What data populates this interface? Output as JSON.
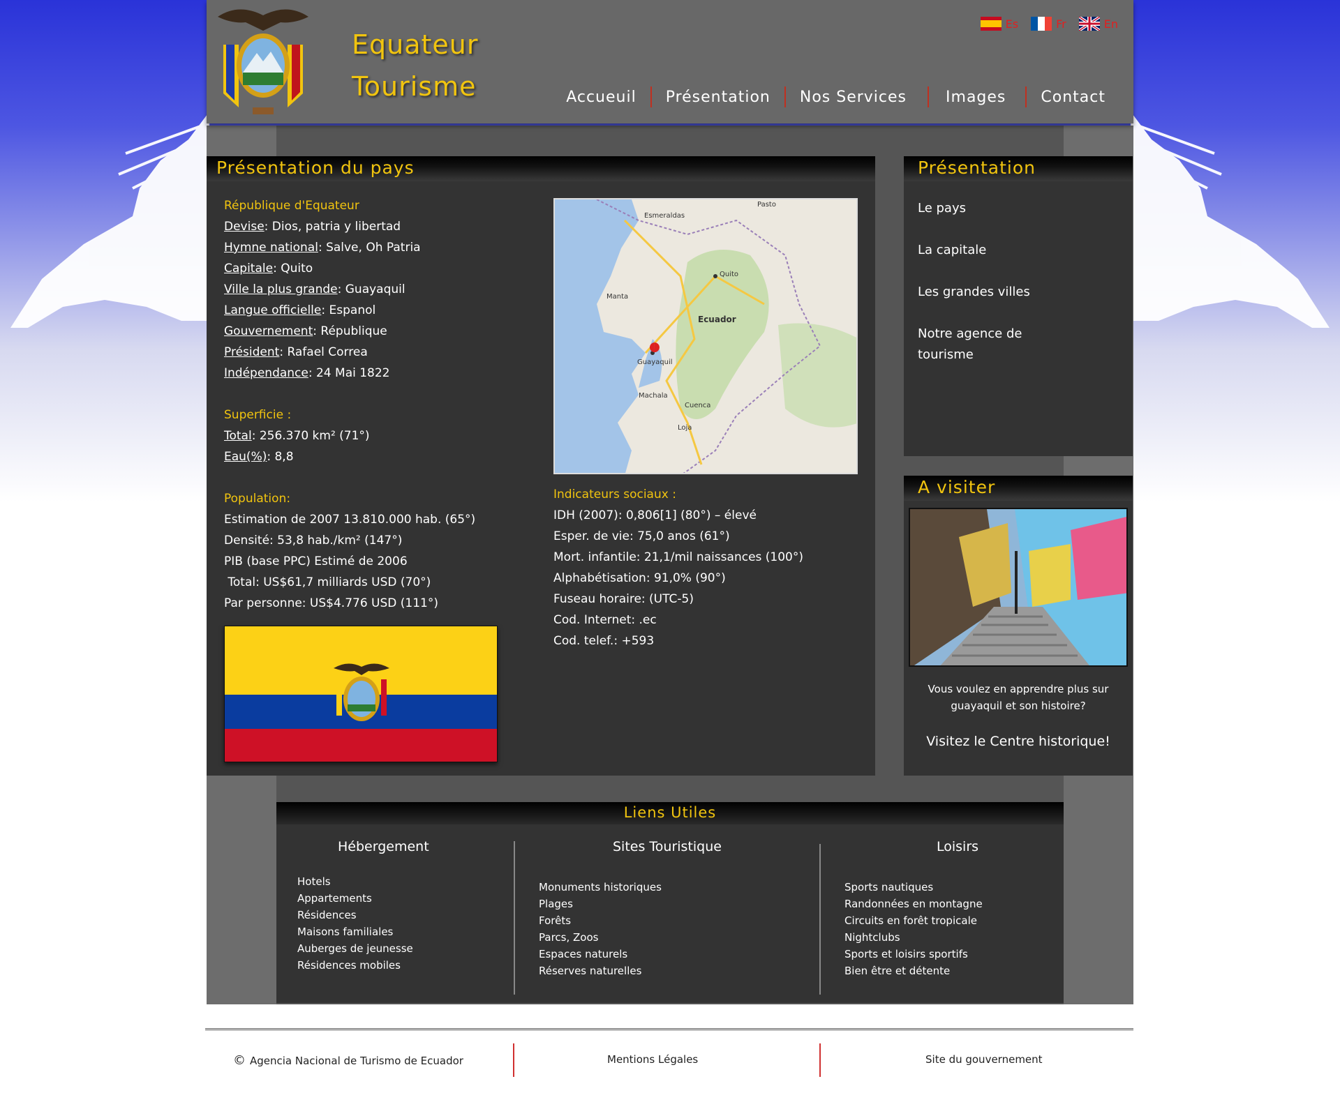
{
  "header": {
    "brand_line1": "Equateur",
    "brand_line2": "Tourisme",
    "languages": [
      {
        "code": "Es",
        "flag": "spain-flag-icon"
      },
      {
        "code": "Fr",
        "flag": "france-flag-icon"
      },
      {
        "code": "En",
        "flag": "uk-flag-icon"
      }
    ],
    "nav": [
      "Accueuil",
      "Présentation",
      "Nos Services",
      "Images",
      "Contact"
    ]
  },
  "main": {
    "title": "Présentation du pays",
    "republic_heading": "République d'Equateur",
    "facts": [
      {
        "label": "Devise",
        "value": ": Dios, patria y libertad"
      },
      {
        "label": "Hymne national",
        "value": ": Salve, Oh Patria"
      },
      {
        "label": "Capitale",
        "value": ": Quito"
      },
      {
        "label": "Ville la plus grande",
        "value": ": Guayaquil"
      },
      {
        "label": "Langue officielle",
        "value": ": Espanol"
      },
      {
        "label": "Gouvernement",
        "value": ": République"
      },
      {
        "label": "Président",
        "value": ": Rafael Correa"
      },
      {
        "label": "Indépendance",
        "value": ": 24 Mai 1822"
      }
    ],
    "superficie_heading": "Superficie :",
    "superficie": [
      {
        "label": "Total",
        "value": ": 256.370 km² (71°)"
      },
      {
        "label": "Eau(%)",
        "value": ": 8,8"
      }
    ],
    "population_heading": "Population:",
    "population": [
      "Estimation de 2007 13.810.000 hab. (65°)",
      "Densité: 53,8 hab./km² (147°)",
      "PIB (base PPC) Estimé de 2006",
      " Total: US$61,7 milliards USD (70°)",
      "Par personne: US$4.776 USD (111°)"
    ],
    "indicators_heading": "Indicateurs sociaux :",
    "indicators": [
      "IDH (2007): 0,806[1] (80°) – élevé",
      "Esper. de vie: 75,0 anos (61°)",
      "Mort. infantile: 21,1/mil naissances (100°)",
      "Alphabétisation: 91,0% (90°)",
      "Fuseau horaire: (UTC-5)",
      "Cod. Internet: .ec",
      "Cod. telef.: +593"
    ],
    "map_labels": {
      "country": "Ecuador",
      "city1": "Quito",
      "city2": "Guayaquil",
      "city3": "Manta",
      "city4": "Cuenca",
      "city5": "Esmeraldas",
      "city6": "Machala",
      "city7": "Loja",
      "city8": "Pasto"
    }
  },
  "sidebar": {
    "title": "Présentation",
    "items": [
      "Le pays",
      "La capitale",
      "Les grandes villes",
      "Notre agence de tourisme"
    ]
  },
  "visit": {
    "title": "A visiter",
    "text": "Vous voulez en apprendre plus sur guayaquil et son histoire?",
    "link": "Visitez le Centre historique!"
  },
  "links": {
    "title": "Liens Utiles",
    "columns": [
      {
        "title": "Hébergement",
        "items": [
          "Hotels",
          "Appartements",
          "Résidences",
          "Maisons familiales",
          "Auberges de jeunesse",
          "Résidences mobiles"
        ]
      },
      {
        "title": "Sites Touristique",
        "items": [
          "Monuments historiques",
          "Plages",
          "Forêts",
          "Parcs, Zoos",
          "Espaces naturels",
          "Réserves naturelles"
        ]
      },
      {
        "title": "Loisirs",
        "items": [
          "Sports nautiques",
          "Randonnées en montagne",
          "Circuits en forêt tropicale",
          "Nightclubs",
          "Sports et loisirs sportifs",
          "Bien être et détente"
        ]
      }
    ]
  },
  "footer": {
    "copyright": "Agencia Nacional de Turismo de Ecuador",
    "legal": "Mentions Légales",
    "gov": "Site du gouvernement"
  },
  "colors": {
    "accent": "#f1c40f",
    "panel": "#333333",
    "header": "#686868",
    "sky": "#2a33d8"
  }
}
